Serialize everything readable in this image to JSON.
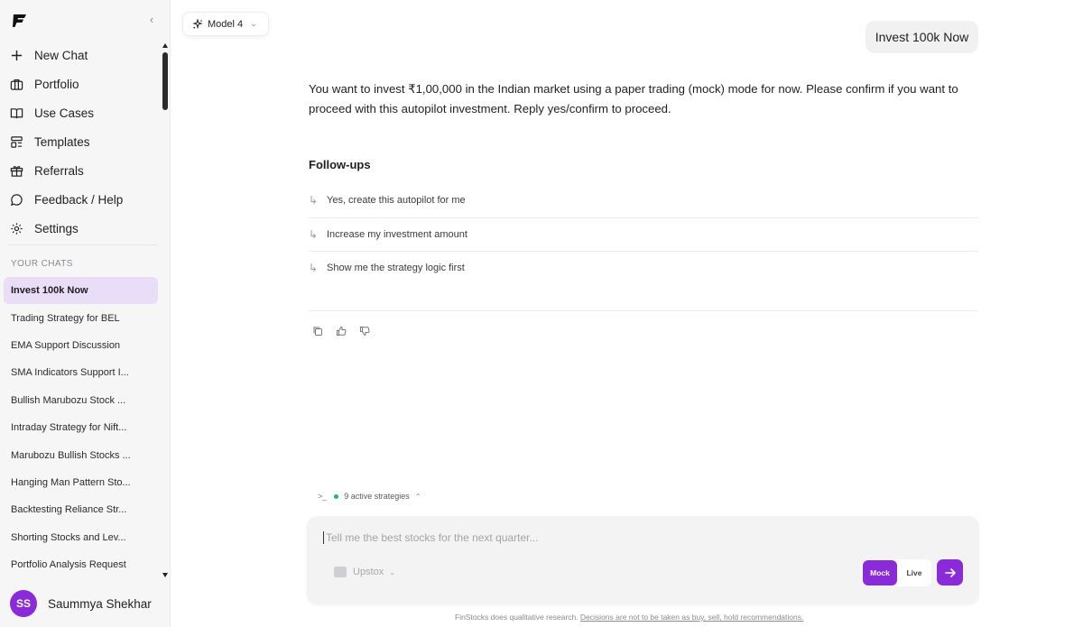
{
  "sidebar": {
    "nav": [
      {
        "label": "New Chat",
        "icon": "plus-icon"
      },
      {
        "label": "Portfolio",
        "icon": "briefcase-icon"
      },
      {
        "label": "Use Cases",
        "icon": "book-icon"
      },
      {
        "label": "Templates",
        "icon": "layout-icon"
      },
      {
        "label": "Referrals",
        "icon": "gift-icon"
      },
      {
        "label": "Feedback / Help",
        "icon": "message-circle-icon"
      },
      {
        "label": "Settings",
        "icon": "gear-icon"
      }
    ],
    "chats_heading": "YOUR CHATS",
    "chats": [
      "Invest 100k Now",
      "Trading Strategy for BEL",
      "EMA Support Discussion",
      "SMA Indicators Support I...",
      "Bullish Marubozu Stock ...",
      "Intraday Strategy for Nift...",
      "Marubozu Bullish Stocks ...",
      "Hanging Man Pattern Sto...",
      "Backtesting Reliance Str...",
      "Shorting Stocks and Lev...",
      "Portfolio Analysis Request"
    ],
    "active_chat": "Invest 100k Now",
    "user": {
      "initials": "SS",
      "name": "Saummya Shekhar"
    }
  },
  "header": {
    "model_label": "Model 4"
  },
  "conversation": {
    "user_message": "Invest 100k Now",
    "assistant_message": "You want to invest ₹1,00,000 in the Indian market using a paper trading (mock) mode for now. Please confirm if you want to proceed with this autopilot investment. Reply yes/confirm to proceed.",
    "followups_title": "Follow-ups",
    "followups": [
      "Yes, create this autopilot for me",
      "Increase my investment amount",
      "Show me the strategy logic first"
    ]
  },
  "composer": {
    "strategies_label": "9 active strategies",
    "placeholder": "Tell me the best stocks for the next quarter...",
    "broker": "Upstox",
    "mode_options": [
      "Mock",
      "Live"
    ],
    "mode_selected": "Mock",
    "disclaimer_prefix": "FinStocks does qualitative research.",
    "disclaimer_link": "Decisions are not to be taken as buy, sell, hold recommendations."
  },
  "colors": {
    "accent": "#8b2ad8",
    "active_chat_bg": "#e9ddf7",
    "status_dot": "#22b573"
  }
}
